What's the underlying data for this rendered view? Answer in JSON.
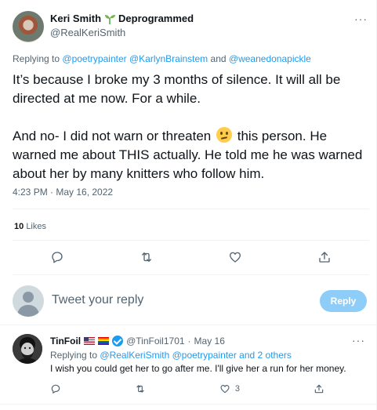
{
  "main_tweet": {
    "display_name": "Keri Smith",
    "name_suffix": "Deprogrammed",
    "handle": "@RealKeriSmith",
    "more": "···",
    "replying_prefix": "Replying to",
    "replying_user1": "@poetrypainter",
    "replying_user2": "@KarlynBrainstem",
    "replying_and": "and",
    "replying_user3": "@weanedonapickle",
    "paragraph1": "It’s because I broke my 3 months of silence. It will all be directed at me now. For a while.",
    "paragraph2_before": "And no- I did not warn or threaten",
    "paragraph2_after": "this person. He warned me about THIS actually. He told me he was warned about her by many knitters who follow him.",
    "timestamp": "4:23 PM · May 16, 2022",
    "likes_count": "10",
    "likes_label": "Likes"
  },
  "composer": {
    "placeholder": "Tweet your reply",
    "reply_button": "Reply"
  },
  "reply_tweet": {
    "display_name": "TinFoil",
    "handle": "@TinFoil1701",
    "separator": "·",
    "date": "May 16",
    "more": "···",
    "replying_prefix": "Replying to",
    "replying_users": "@RealKeriSmith @poetrypainter and 2 others",
    "text": "I wish you could get her to go after me. I'll give her a run for her money.",
    "like_count": "3"
  },
  "colors": {
    "accent": "#1d9bf0",
    "reply_button_disabled": "#8ecdf8",
    "muted_text": "#536471"
  },
  "icons": [
    "sprout-icon",
    "reply-icon",
    "retweet-icon",
    "like-icon",
    "share-icon",
    "verified-icon",
    "flag-us-icon",
    "flag-rainbow-icon",
    "more-icon"
  ]
}
